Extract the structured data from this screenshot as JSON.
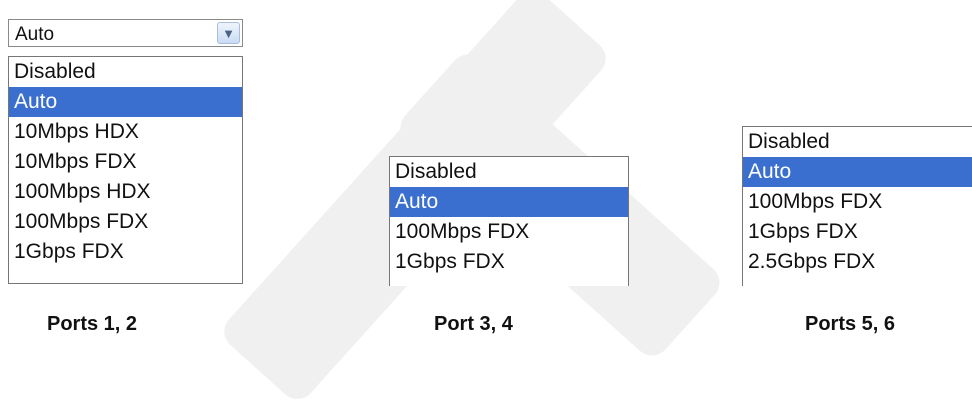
{
  "panel1": {
    "select_value": "Auto",
    "dropdown_icon": "chevron-down-icon",
    "options": [
      "Disabled",
      "Auto",
      "10Mbps HDX",
      "10Mbps FDX",
      "100Mbps HDX",
      "100Mbps FDX",
      "1Gbps FDX"
    ],
    "selected": "Auto",
    "caption": "Ports 1, 2"
  },
  "panel2": {
    "options": [
      "Disabled",
      "Auto",
      "100Mbps FDX",
      "1Gbps FDX"
    ],
    "selected": "Auto",
    "caption": "Port 3, 4"
  },
  "panel3": {
    "options": [
      "Disabled",
      "Auto",
      "100Mbps FDX",
      "1Gbps FDX",
      "2.5Gbps FDX"
    ],
    "selected": "Auto",
    "caption": "Ports 5, 6"
  },
  "colors": {
    "selection_bg": "#3a6fcf",
    "selection_text": "#ffffff"
  }
}
